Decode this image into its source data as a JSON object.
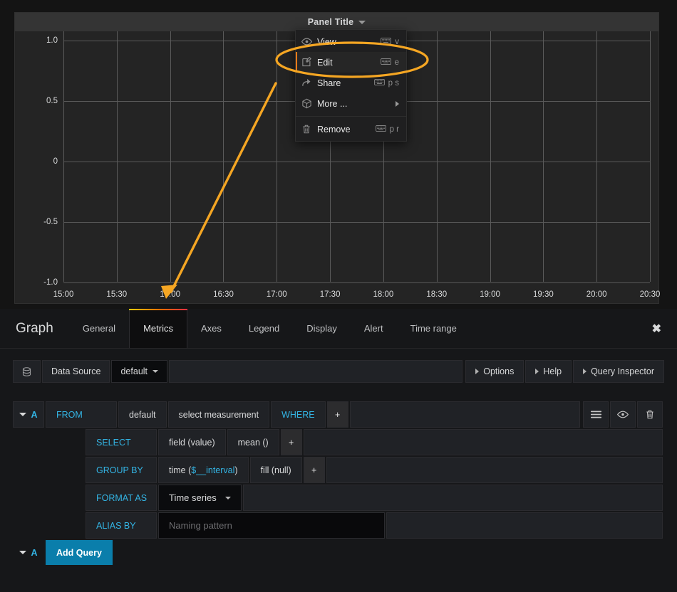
{
  "panel": {
    "title": "Panel Title",
    "menu": {
      "items": [
        {
          "label": "View",
          "icon": "eye-icon",
          "shortcut": "v",
          "has_kbd": true,
          "submenu": false,
          "active": false
        },
        {
          "label": "Edit",
          "icon": "edit-icon",
          "shortcut": "e",
          "has_kbd": true,
          "submenu": false,
          "active": true
        },
        {
          "label": "Share",
          "icon": "share-icon",
          "shortcut": "p s",
          "has_kbd": true,
          "submenu": false,
          "active": false
        },
        {
          "label": "More ...",
          "icon": "cube-icon",
          "shortcut": "",
          "has_kbd": false,
          "submenu": true,
          "active": false
        }
      ],
      "remove": {
        "label": "Remove",
        "icon": "trash-icon",
        "shortcut": "p r",
        "has_kbd": true
      }
    },
    "chart_data": {
      "type": "line",
      "title": "Panel Title",
      "series": [],
      "x": [],
      "xlabel": "",
      "ylabel": "",
      "ylim": [
        -1.0,
        1.0
      ],
      "y_ticks": [
        "1.0",
        "0.5",
        "0",
        "-0.5",
        "-1.0"
      ],
      "y_tick_values": [
        1.0,
        0.5,
        0,
        -0.5,
        -1.0
      ],
      "x_ticks": [
        "15:00",
        "15:30",
        "16:00",
        "16:30",
        "17:00",
        "17:30",
        "18:00",
        "18:30",
        "19:00",
        "19:30",
        "20:00",
        "20:30"
      ],
      "grid": true,
      "legend": "none",
      "no_data": true
    }
  },
  "annotations": {
    "highlight_color": "#f5a623",
    "ellipse_target": "Edit",
    "arrow_from": "Edit menu item",
    "arrow_to": "Metrics tab"
  },
  "editor": {
    "title": "Graph",
    "tabs": [
      {
        "label": "General",
        "active": false
      },
      {
        "label": "Metrics",
        "active": true
      },
      {
        "label": "Axes",
        "active": false
      },
      {
        "label": "Legend",
        "active": false
      },
      {
        "label": "Display",
        "active": false
      },
      {
        "label": "Alert",
        "active": false
      },
      {
        "label": "Time range",
        "active": false
      }
    ],
    "close_label": "✖",
    "datasource": {
      "icon": "database-icon",
      "label": "Data Source",
      "value": "default",
      "buttons": [
        {
          "label": "Options"
        },
        {
          "label": "Help"
        },
        {
          "label": "Query Inspector"
        }
      ]
    },
    "query": {
      "ref_id": "A",
      "rows": {
        "from": {
          "key": "FROM",
          "policy": "default",
          "measurement": "select measurement",
          "where_keyword": "WHERE",
          "plus": "+"
        },
        "select": {
          "key": "SELECT",
          "field": "field (value)",
          "func": "mean ()",
          "plus": "+"
        },
        "group_by": {
          "key": "GROUP BY",
          "time": "time (",
          "time_var": "$__interval",
          "time_close": ")",
          "fill": "fill (null)",
          "plus": "+"
        },
        "format_as": {
          "key": "FORMAT AS",
          "value": "Time series"
        },
        "alias_by": {
          "key": "ALIAS BY",
          "placeholder": "Naming pattern",
          "value": ""
        }
      },
      "actions": [
        {
          "name": "hamburger-icon"
        },
        {
          "name": "eye-icon"
        },
        {
          "name": "trash-icon"
        }
      ],
      "add_query_label": "Add Query",
      "add_query_ref": "A"
    }
  },
  "colors": {
    "accent_orange": "#eb7b18",
    "link_blue": "#33b5e5",
    "primary_blue": "#0a7eab",
    "panel_bg": "#2b2b2b",
    "editor_bg": "#161719"
  }
}
